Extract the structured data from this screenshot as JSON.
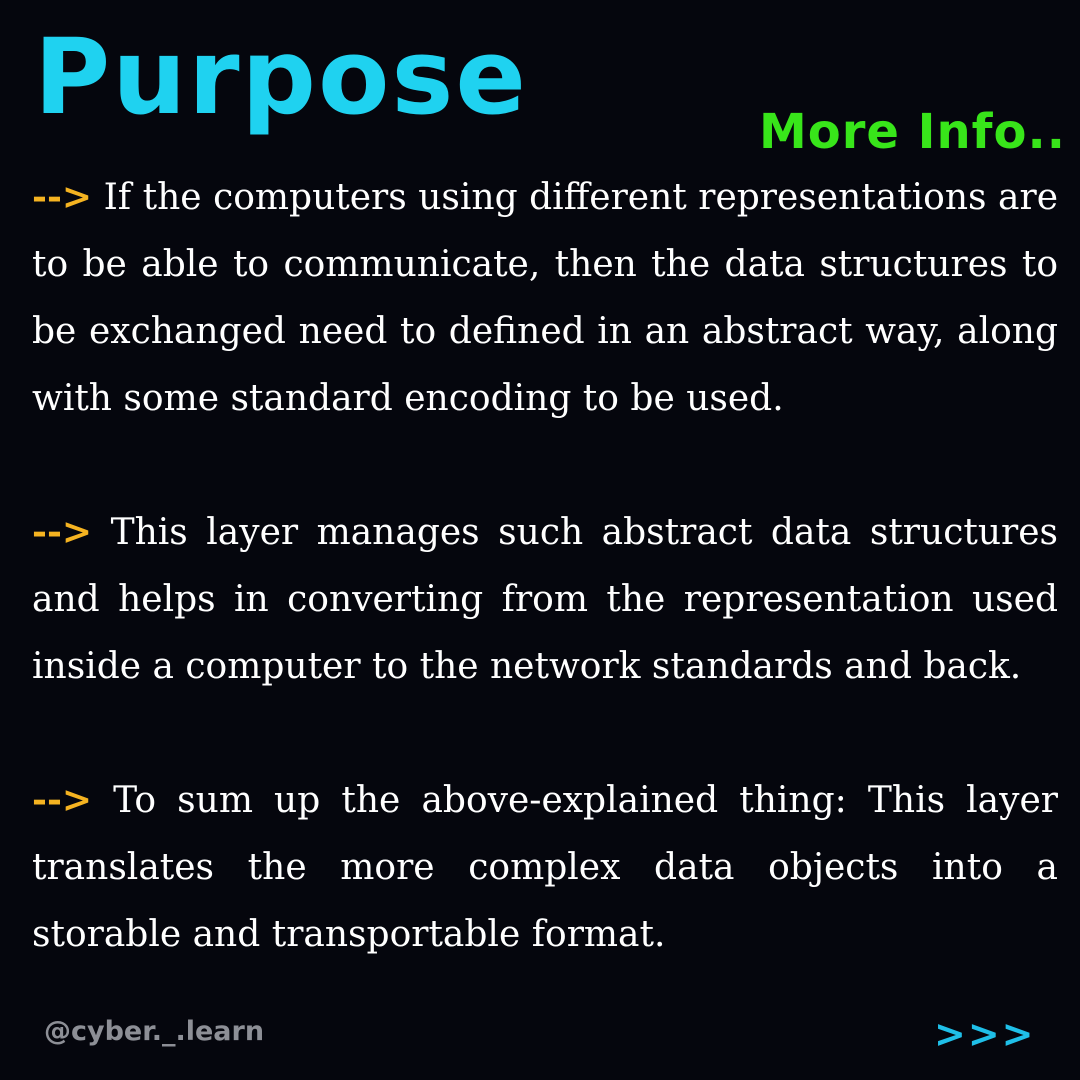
{
  "title": "Purpose",
  "more_info": "More Info..",
  "arrow_glyph": "-->",
  "paragraphs": [
    "If the computers using different representations are to be able to communicate, then the data structures to be exchanged need to defined in an abstract way, along with some standard encoding to be used.",
    "This layer manages such abstract data structures and helps in converting from the representation used inside a computer to the network standards and back.",
    "To sum up the above-explained thing: This layer translates the more complex data objects into a storable and transportable format."
  ],
  "handle": "@cyber._.learn",
  "next_indicator": ">>>",
  "colors": {
    "background": "#05060d",
    "title": "#1fd2f0",
    "accent_green": "#38e51a",
    "arrow": "#f5b321",
    "handle": "#8d8f96",
    "next": "#1fbfe8",
    "body_text": "#ffffff"
  }
}
